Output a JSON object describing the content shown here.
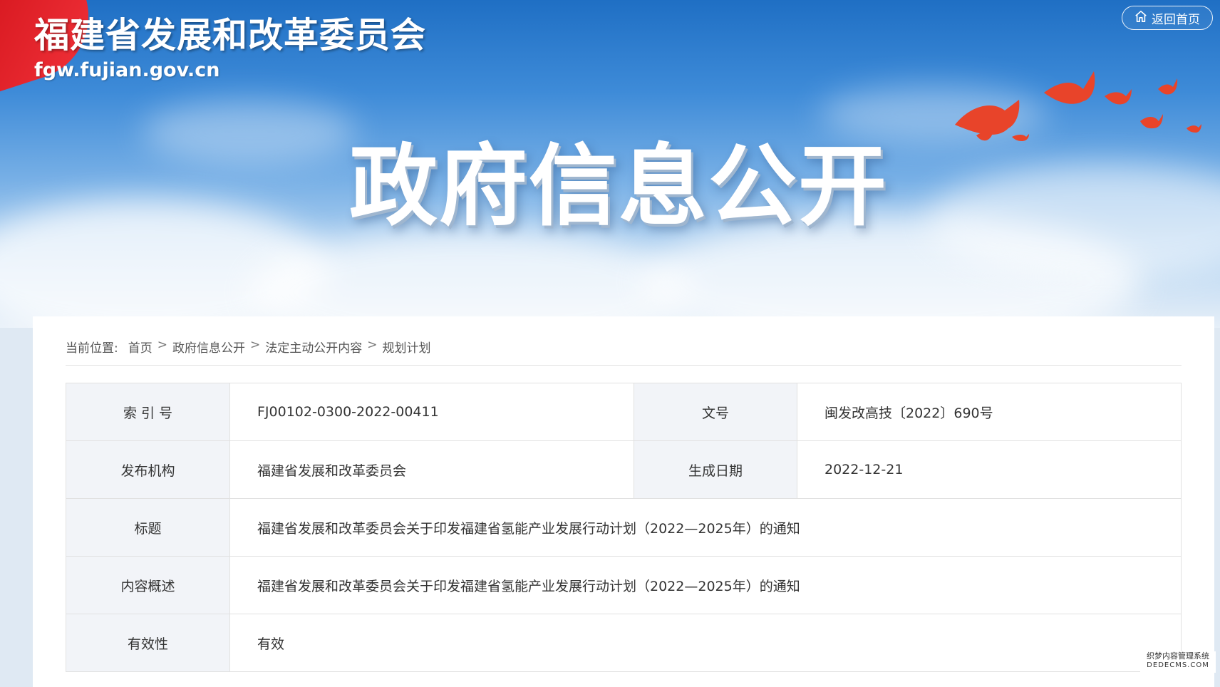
{
  "header": {
    "site_name": "福建省发展和改革委员会",
    "site_url": "fgw.fujian.gov.cn",
    "home_button": "返回首页",
    "hero_title": "政府信息公开"
  },
  "breadcrumb": {
    "label": "当前位置:",
    "items": [
      "首页",
      "政府信息公开",
      "法定主动公开内容",
      "规划计划"
    ],
    "separator": ">"
  },
  "info_table": {
    "index_label": "索 引 号",
    "index_value": "FJ00102-0300-2022-00411",
    "docnum_label": "文号",
    "docnum_value": "闽发改高技〔2022〕690号",
    "publisher_label": "发布机构",
    "publisher_value": "福建省发展和改革委员会",
    "date_label": "生成日期",
    "date_value": "2022-12-21",
    "title_label": "标题",
    "title_value": "福建省发展和改革委员会关于印发福建省氢能产业发展行动计划（2022—2025年）的通知",
    "summary_label": "内容概述",
    "summary_value": "福建省发展和改革委员会关于印发福建省氢能产业发展行动计划（2022—2025年）的通知",
    "validity_label": "有效性",
    "validity_value": "有效"
  },
  "watermark": {
    "line1": "织梦内容管理系统",
    "line2": "DEDECMS.COM"
  },
  "colors": {
    "sky_top": "#1f6fc4",
    "ribbon_red": "#d3141b",
    "table_header_bg": "#f2f4f8"
  }
}
